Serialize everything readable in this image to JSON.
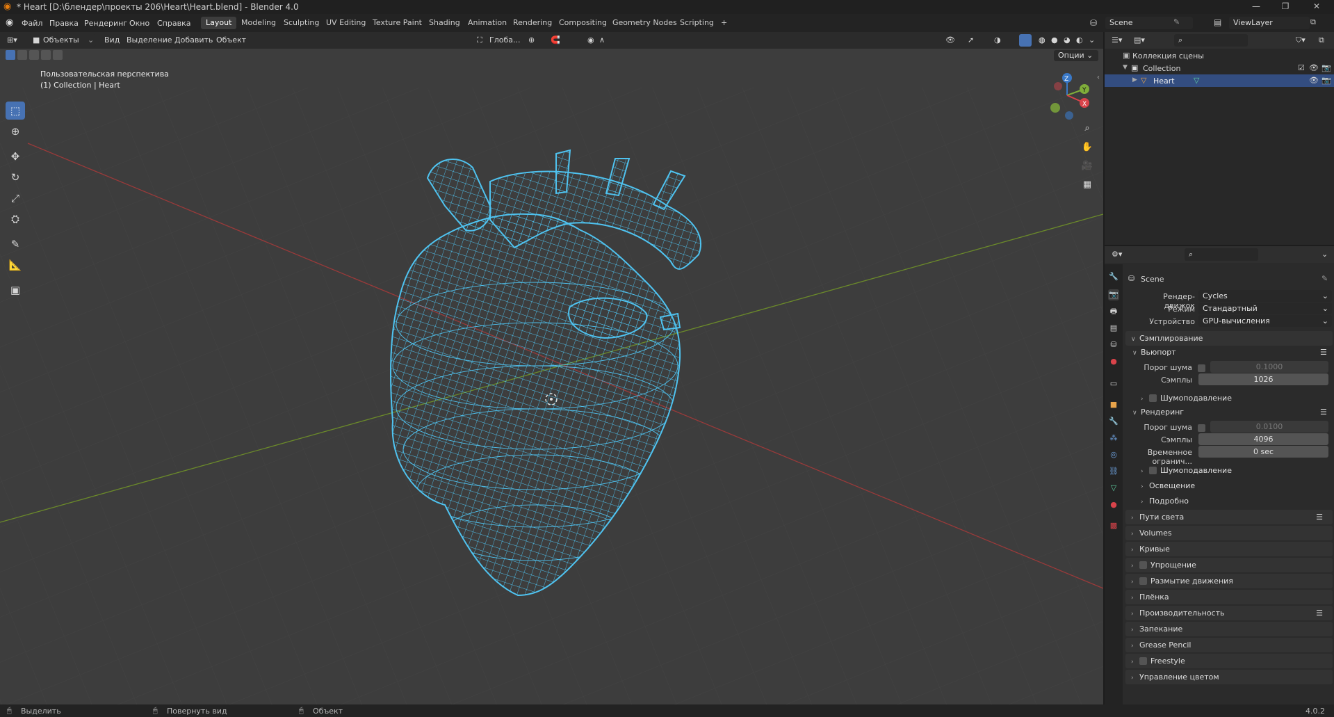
{
  "window": {
    "title": "* Heart [D:\\блендер\\проекты 206\\Heart\\Heart.blend] - Blender 4.0",
    "minimize": "—",
    "maximize": "❐",
    "close": "✕"
  },
  "menu": [
    "Файл",
    "Правка",
    "Рендеринг",
    "Окно",
    "Справка"
  ],
  "workspaces": [
    "Layout",
    "Modeling",
    "Sculpting",
    "UV Editing",
    "Texture Paint",
    "Shading",
    "Animation",
    "Rendering",
    "Compositing",
    "Geometry Nodes",
    "Scripting"
  ],
  "workspace_add": "+",
  "scene": {
    "name": "Scene",
    "view_layer": "ViewLayer"
  },
  "viewport": {
    "mode": "Объекты",
    "menus": [
      "Вид",
      "Выделение",
      "Добавить",
      "Объект"
    ],
    "transform_orientation": "Глоба...",
    "options": "Опции",
    "overlay_line1": "Пользовательская перспектива",
    "overlay_line2": "(1) Collection | Heart",
    "gizmo_axes": {
      "x": "X",
      "y": "Y",
      "z": "Z"
    },
    "wire_color": "#4fc3f0"
  },
  "outliner": {
    "root": "Коллекция сцены",
    "collection": "Collection",
    "object": "Heart"
  },
  "properties": {
    "context": "Scene",
    "render_engine_label": "Рендер-движок",
    "render_engine": "Cycles",
    "mode_label": "Режим",
    "mode": "Стандартный",
    "device_label": "Устройство",
    "device": "GPU-вычисления",
    "sampling": "Сэмплирование",
    "viewport": "Вьюпорт",
    "noise_threshold_label": "Порог шума",
    "viewport_noise": "0.1000",
    "samples_label": "Сэмплы",
    "viewport_samples": "1026",
    "denoise": "Шумоподавление",
    "render": "Рендеринг",
    "render_noise": "0.0100",
    "render_samples": "4096",
    "time_limit_label": "Временное огранич...",
    "time_limit": "0 sec",
    "render_denoise": "Шумоподавление",
    "lighting": "Освещение",
    "advanced": "Подробно",
    "panels": [
      "Пути света",
      "Volumes",
      "Кривые",
      "Упрощение",
      "Размытие движения",
      "Плёнка",
      "Производительность",
      "Запекание",
      "Grease Pencil",
      "Freestyle",
      "Управление цветом"
    ]
  },
  "status": {
    "select": "Выделить",
    "rotate": "Повернуть вид",
    "object": "Объект",
    "version": "4.0.2"
  }
}
